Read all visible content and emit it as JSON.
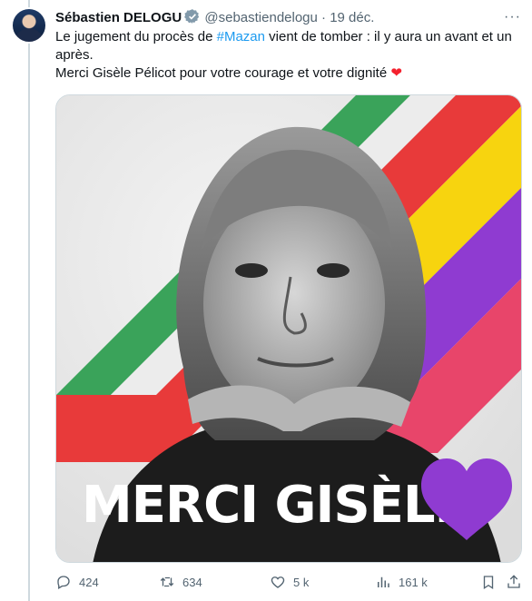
{
  "tweet": {
    "author_name": "Sébastien DELOGU",
    "handle": "@sebastiendelogu",
    "separator": "·",
    "date": "19 déc.",
    "text_before": "Le jugement du procès de ",
    "hashtag": "#Mazan",
    "text_after": " vient de tomber : il y aura un avant et un après.",
    "line2": "Merci Gisèle Pélicot pour votre courage et votre dignité ",
    "emoji": "❤️"
  },
  "media": {
    "overlay_text": "MERCI GISÈLE",
    "stripe_colors": [
      "#3aa35a",
      "#e6e6e6",
      "#e83a3a",
      "#f7d40f",
      "#8f3bd1",
      "#e83a6a"
    ],
    "heart_color": "#8f3bd1"
  },
  "actions": {
    "replies": "424",
    "reposts": "634",
    "likes": "5 k",
    "views": "161 k"
  },
  "icons": [
    "verified-icon",
    "more-icon",
    "reply-icon",
    "repost-icon",
    "like-icon",
    "views-icon",
    "bookmark-icon",
    "share-icon"
  ]
}
